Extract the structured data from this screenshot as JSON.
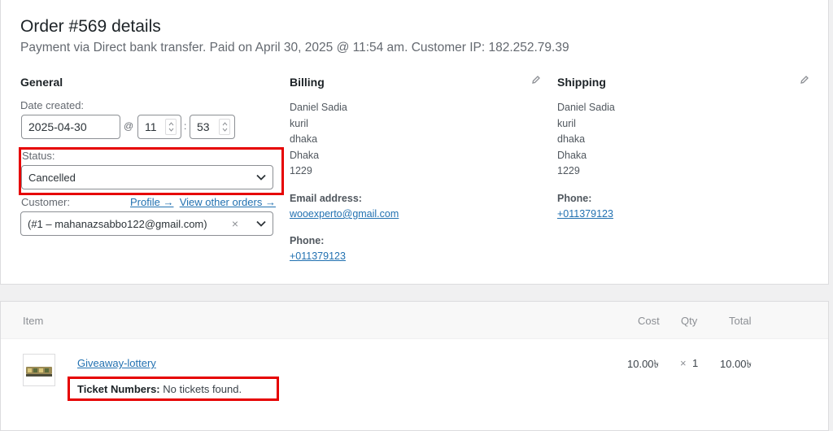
{
  "order": {
    "title": "Order #569 details",
    "subtitle": "Payment via Direct bank transfer. Paid on April 30, 2025 @ 11:54 am. Customer IP: 182.252.79.39"
  },
  "general": {
    "heading": "General",
    "date_label": "Date created:",
    "date_value": "2025-04-30",
    "at_sign": "@",
    "hour": "11",
    "colon": ":",
    "minute": "53",
    "status_label": "Status:",
    "status_value": "Cancelled",
    "customer_label": "Customer:",
    "profile_link": "Profile →",
    "other_orders_link": "View other orders →",
    "customer_value": "(#1 – mahanazsabbo122@gmail.com)",
    "clear_symbol": "×"
  },
  "billing": {
    "heading": "Billing",
    "address": [
      "Daniel Sadia",
      "kuril",
      "dhaka",
      "Dhaka",
      "1229"
    ],
    "email_label": "Email address:",
    "email": "wooexperto@gmail.com",
    "phone_label": "Phone:",
    "phone": "+011379123"
  },
  "shipping": {
    "heading": "Shipping",
    "address": [
      "Daniel Sadia",
      "kuril",
      "dhaka",
      "Dhaka",
      "1229"
    ],
    "phone_label": "Phone:",
    "phone": "+011379123"
  },
  "items": {
    "headers": {
      "item": "Item",
      "cost": "Cost",
      "qty": "Qty",
      "total": "Total"
    },
    "rows": [
      {
        "name": "Giveaway-lottery",
        "meta_label": "Ticket Numbers:",
        "meta_value": "No tickets found.",
        "cost": "10.00৳",
        "qty_prefix": "×",
        "qty": "1",
        "total": "10.00৳"
      }
    ]
  },
  "colors": {
    "highlight": "#e60000",
    "link": "#2271b1"
  },
  "icons": [
    "pencil-icon",
    "chevron-down-icon",
    "spinner-arrows-icon",
    "product-thumbnail"
  ]
}
